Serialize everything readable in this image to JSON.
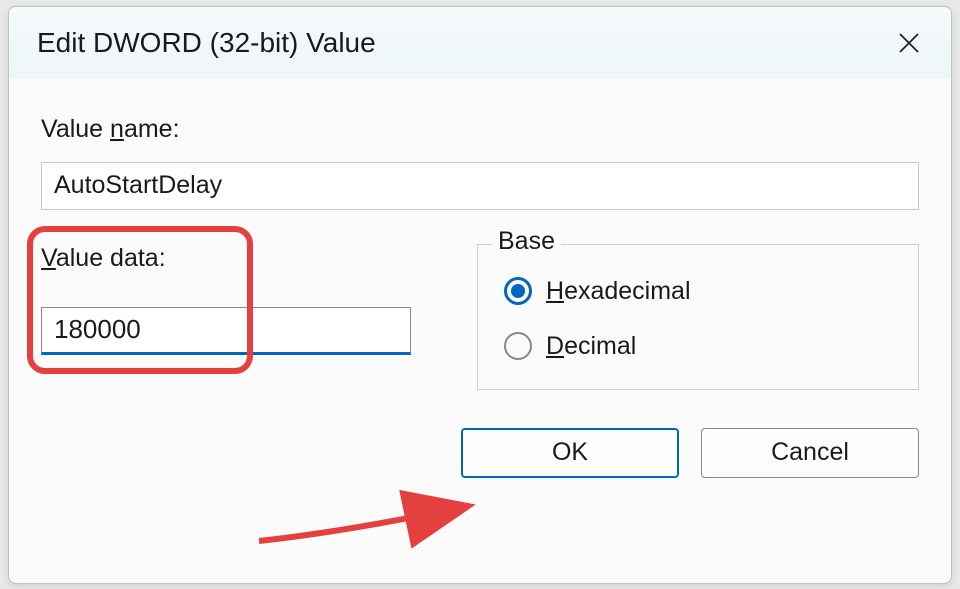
{
  "dialog": {
    "title": "Edit DWORD (32-bit) Value",
    "value_name_label": "Value name:",
    "value_name_label_prefix": "Value ",
    "value_name_label_u": "n",
    "value_name_label_suffix": "ame:",
    "value_name": "AutoStartDelay",
    "value_data_label_u": "V",
    "value_data_label_suffix": "alue data:",
    "value_data": "180000",
    "base_label": "Base",
    "hex_label_u": "H",
    "hex_label_suffix": "exadecimal",
    "dec_label_u": "D",
    "dec_label_suffix": "ecimal",
    "base_selected": "hexadecimal",
    "ok_label": "OK",
    "cancel_label": "Cancel"
  }
}
